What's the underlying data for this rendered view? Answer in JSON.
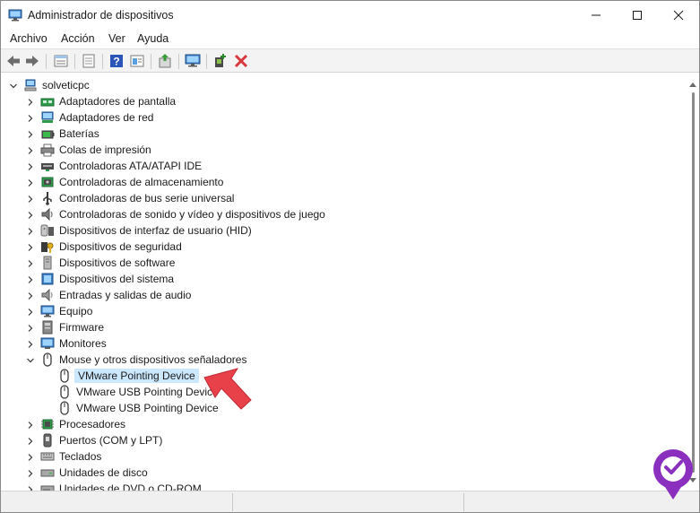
{
  "window": {
    "title": "Administrador de dispositivos",
    "minimize_icon": "minimize-icon",
    "maximize_icon": "maximize-icon",
    "close_icon": "close-icon"
  },
  "menu": {
    "items": [
      "Archivo",
      "Acción",
      "Ver",
      "Ayuda"
    ]
  },
  "toolbar": {
    "buttons": [
      "back-icon",
      "forward-icon",
      "properties-list-icon",
      "properties-page-icon",
      "help-icon",
      "view-icon",
      "update-driver-icon",
      "scan-hardware-icon",
      "add-device-icon",
      "uninstall-icon"
    ]
  },
  "tree": {
    "root": "solveticpc",
    "categories": [
      {
        "label": "Adaptadores de pantalla",
        "icon": "display-adapter-icon",
        "expanded": false
      },
      {
        "label": "Adaptadores de red",
        "icon": "network-adapter-icon",
        "expanded": false
      },
      {
        "label": "Baterías",
        "icon": "battery-icon",
        "expanded": false
      },
      {
        "label": "Colas de impresión",
        "icon": "printer-icon",
        "expanded": false
      },
      {
        "label": "Controladoras ATA/ATAPI IDE",
        "icon": "ide-controller-icon",
        "expanded": false
      },
      {
        "label": "Controladoras de almacenamiento",
        "icon": "storage-controller-icon",
        "expanded": false
      },
      {
        "label": "Controladoras de bus serie universal",
        "icon": "usb-icon",
        "expanded": false
      },
      {
        "label": "Controladoras de sonido y vídeo y dispositivos de juego",
        "icon": "speaker-icon",
        "expanded": false
      },
      {
        "label": "Dispositivos de interfaz de usuario (HID)",
        "icon": "hid-icon",
        "expanded": false
      },
      {
        "label": "Dispositivos de seguridad",
        "icon": "security-key-icon",
        "expanded": false
      },
      {
        "label": "Dispositivos de software",
        "icon": "software-device-icon",
        "expanded": false
      },
      {
        "label": "Dispositivos del sistema",
        "icon": "system-device-icon",
        "expanded": false
      },
      {
        "label": "Entradas y salidas de audio",
        "icon": "audio-io-icon",
        "expanded": false
      },
      {
        "label": "Equipo",
        "icon": "computer-icon",
        "expanded": false
      },
      {
        "label": "Firmware",
        "icon": "firmware-icon",
        "expanded": false
      },
      {
        "label": "Monitores",
        "icon": "monitor-icon",
        "expanded": false
      },
      {
        "label": "Mouse y otros dispositivos señaladores",
        "icon": "mouse-icon",
        "expanded": true,
        "children": [
          "VMware Pointing Device",
          "VMware USB Pointing Device",
          "VMware USB Pointing Device"
        ]
      },
      {
        "label": "Procesadores",
        "icon": "processor-icon",
        "expanded": false
      },
      {
        "label": "Puertos (COM y LPT)",
        "icon": "port-icon",
        "expanded": false
      },
      {
        "label": "Teclados",
        "icon": "keyboard-icon",
        "expanded": false
      },
      {
        "label": "Unidades de disco",
        "icon": "disk-drive-icon",
        "expanded": false
      },
      {
        "label": "Unidades de DVD o CD-ROM",
        "icon": "dvd-drive-icon",
        "expanded": false
      }
    ]
  },
  "selected_item": "VMware Pointing Device",
  "annotation": {
    "icon": "red-pointer-arrow-icon",
    "color": "#e8414a"
  },
  "watermark": {
    "icon": "solvetic-logo-icon",
    "color": "#8b2fbf"
  },
  "colors": {
    "selection": "#cce8ff",
    "toolbar_bg": "#f3f3f3",
    "close_red": "#d9363e"
  }
}
